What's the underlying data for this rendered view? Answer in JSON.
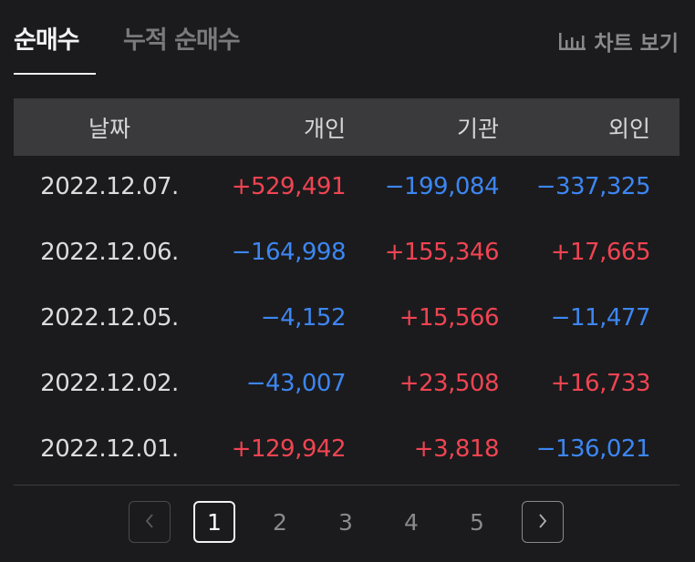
{
  "tabs": {
    "active_label": "순매수",
    "inactive_label": "누적 순매수"
  },
  "chart_button": {
    "icon": "bar-chart-icon",
    "label": "차트 보기"
  },
  "table": {
    "headers": {
      "date": "날짜",
      "individual": "개인",
      "institution": "기관",
      "foreign": "외인"
    },
    "rows": [
      {
        "date": "2022.12.07.",
        "individual": "+529,491",
        "institution": "−199,084",
        "foreign": "−337,325"
      },
      {
        "date": "2022.12.06.",
        "individual": "−164,998",
        "institution": "+155,346",
        "foreign": "+17,665"
      },
      {
        "date": "2022.12.05.",
        "individual": "−4,152",
        "institution": "+15,566",
        "foreign": "−11,477"
      },
      {
        "date": "2022.12.02.",
        "individual": "−43,007",
        "institution": "+23,508",
        "foreign": "+16,733"
      },
      {
        "date": "2022.12.01.",
        "individual": "+129,942",
        "institution": "+3,818",
        "foreign": "−136,021"
      }
    ]
  },
  "pagination": {
    "prev_icon": "chevron-left-icon",
    "next_icon": "chevron-right-icon",
    "pages": [
      "1",
      "2",
      "3",
      "4",
      "5"
    ],
    "current": "1"
  },
  "colors": {
    "positive": "#f04452",
    "negative": "#3d86f2",
    "background": "#1b1b1d",
    "header_bg": "#3a3a3c"
  }
}
